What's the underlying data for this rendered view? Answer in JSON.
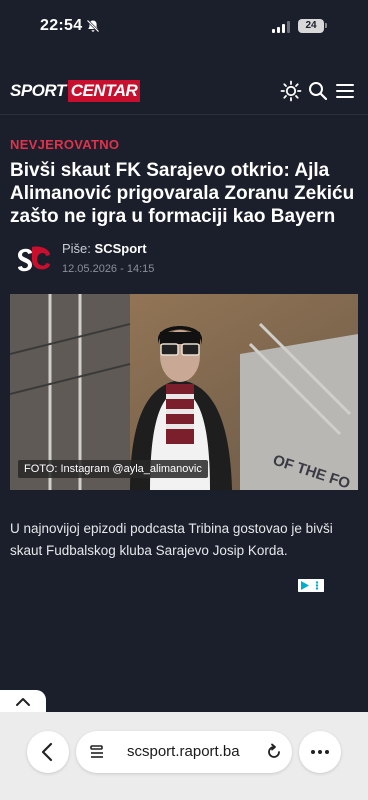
{
  "status_bar": {
    "time": "22:54",
    "battery": "24"
  },
  "header": {
    "logo_part1": "SPORT",
    "logo_part2": "CENTAR",
    "icons": [
      "sun-icon",
      "search-icon",
      "menu-icon"
    ]
  },
  "article": {
    "category": "NEVJEROVATNO",
    "headline": "Bivši skaut FK Sarajevo otkrio: Ajla Alimanović prigovarala Zoranu Zekiću zašto ne igra u formaciji kao Bayern",
    "avatar_text": "SC",
    "byline_label": "Piše:",
    "author": "SCSport",
    "date": "12.05.2026 - 14:15",
    "photo_caption": "FOTO: Instagram @ayla_alimanovic",
    "body": "U najnovijoj epizodi podcasta Tribina gostovao je bivši skaut Fudbalskog kluba Sarajevo Josip Korda."
  },
  "browser": {
    "url": "scsport.raport.ba",
    "buttons": [
      "back-icon",
      "reader-icon",
      "reload-icon",
      "more-icon"
    ]
  },
  "colors": {
    "accent": "#c8102e",
    "category": "#e0324b",
    "background": "#1b1f2b"
  }
}
